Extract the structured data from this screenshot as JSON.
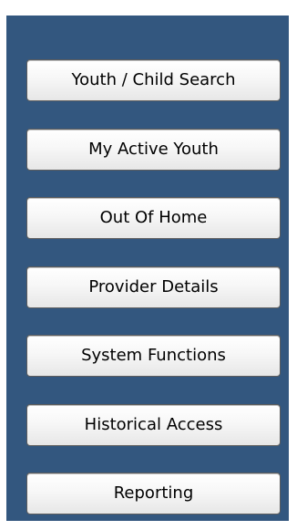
{
  "colors": {
    "panel_background": "#33577f",
    "button_border": "#5d5d5d",
    "button_text": "#000000"
  },
  "navigation": {
    "buttons": [
      {
        "label": "Youth / Child Search"
      },
      {
        "label": "My Active Youth"
      },
      {
        "label": "Out Of Home"
      },
      {
        "label": "Provider Details"
      },
      {
        "label": "System Functions"
      },
      {
        "label": "Historical Access"
      },
      {
        "label": "Reporting"
      }
    ]
  }
}
